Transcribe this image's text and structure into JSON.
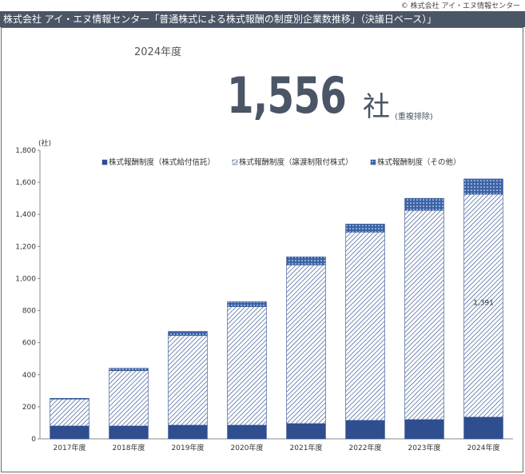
{
  "copyright": "© 株式会社 アイ・エヌ情報センター",
  "title": "株式会社 アイ・エヌ情報センター「普通株式による株式報酬の制度別企業数推移」（決議日ベース）」",
  "summary": {
    "year_label": "2024年度",
    "total": "1,556",
    "unit": "社",
    "note": "(重複排除)"
  },
  "colors": {
    "title_bar": "#4a5566",
    "series_solid": "#2e4e8f",
    "series_hatch": "#2e4e8f",
    "series_dots": "#3a63a8"
  },
  "chart_data": {
    "type": "bar",
    "stacked": true,
    "unit_label": "(社)",
    "categories": [
      "2017年度",
      "2018年度",
      "2019年度",
      "2020年度",
      "2021年度",
      "2022年度",
      "2023年度",
      "2024年度"
    ],
    "series": [
      {
        "name": "株式報酬制度（株式給付信託）",
        "pattern": "solid",
        "values": [
          80,
          80,
          85,
          85,
          95,
          115,
          120,
          135
        ]
      },
      {
        "name": "株式報酬制度（譲渡制限付株式）",
        "pattern": "hatch",
        "values": [
          168,
          345,
          560,
          740,
          990,
          1175,
          1305,
          1391
        ]
      },
      {
        "name": "株式報酬制度（その他）",
        "pattern": "dots",
        "values": [
          5,
          15,
          25,
          30,
          50,
          50,
          75,
          95
        ]
      }
    ],
    "data_labels": [
      {
        "series": 1,
        "category": 7,
        "text": "1,391"
      }
    ],
    "y_ticks": [
      "0",
      "200",
      "400",
      "600",
      "800",
      "1,000",
      "1,200",
      "1,400",
      "1,600",
      "1,800"
    ],
    "ylim": [
      0,
      1800
    ],
    "grid": false,
    "legend": "top"
  }
}
